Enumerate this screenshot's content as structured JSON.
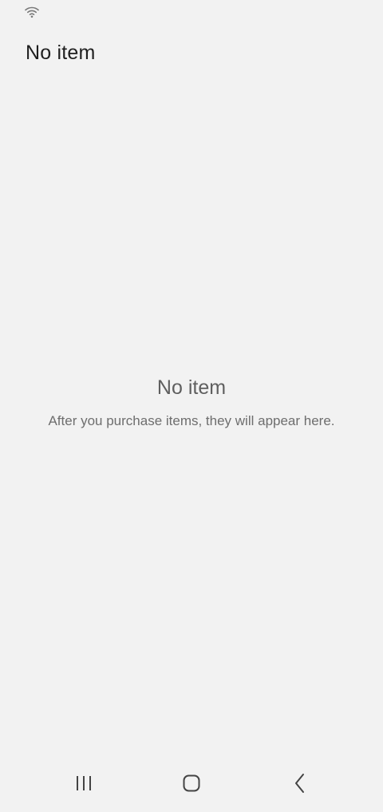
{
  "status_bar": {
    "wifi_icon": "wifi-icon"
  },
  "header": {
    "title": "No item"
  },
  "empty_state": {
    "title": "No item",
    "description": "After you purchase items, they will appear here."
  },
  "nav_bar": {
    "recents_icon": "recents-icon",
    "home_icon": "home-icon",
    "back_icon": "back-icon"
  },
  "colors": {
    "background": "#f2f2f2",
    "title_text": "#1f1f1f",
    "empty_title_text": "#5f5f5f",
    "empty_desc_text": "#6e6e6e",
    "nav_icon": "#444444"
  }
}
